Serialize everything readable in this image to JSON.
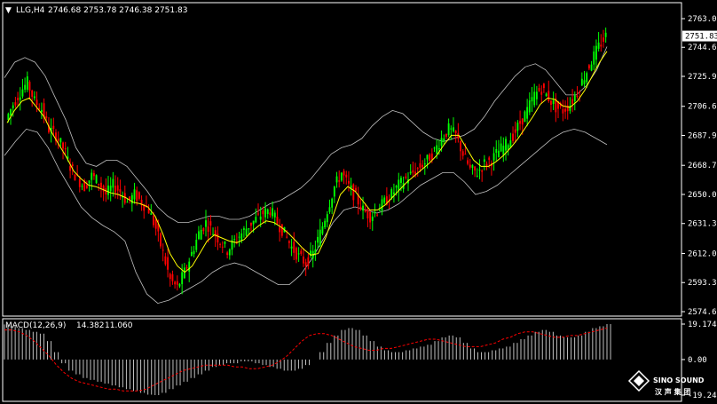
{
  "header": {
    "menu_glyph": "▼",
    "symbol": "LLG,H4",
    "ohlc": "2746.68 2753.78 2746.38 2751.83"
  },
  "macd": {
    "label": "MACD(12,26,9)",
    "main_value": "14.382",
    "signal_value": "11.060",
    "axis_ticks": [
      "19.174",
      "0.00",
      "-19.24"
    ]
  },
  "watermark": {
    "brand": "SINO SOUND",
    "cjk": "汉 声 集 团"
  },
  "colors": {
    "background": "#000000",
    "bull": "#00FF00",
    "bear": "#FF0000",
    "price_label_bg": "#FFFFFF",
    "ma_line": "#FFFF00",
    "band": "#C0C0C0",
    "macd_hist": "#C0C0C0",
    "macd_signal": "#FF0000"
  },
  "chart_data": {
    "type": "candlestick",
    "y_axis_ticks": [
      "2763.00",
      "2744.60",
      "2725.90",
      "2706.65",
      "2687.95",
      "2668.70",
      "2650.00",
      "2631.30",
      "2612.05",
      "2593.35",
      "2574.65"
    ],
    "last_price": "2751.83",
    "ylim": [
      2574.65,
      2763.0
    ],
    "price_path": [
      2698,
      2708,
      2716,
      2722,
      2710,
      2705,
      2692,
      2688,
      2680,
      2668,
      2660,
      2655,
      2662,
      2658,
      2650,
      2656,
      2652,
      2645,
      2650,
      2645,
      2640,
      2628,
      2612,
      2595,
      2590,
      2600,
      2612,
      2625,
      2632,
      2626,
      2620,
      2614,
      2620,
      2625,
      2630,
      2634,
      2638,
      2640,
      2632,
      2625,
      2616,
      2610,
      2606,
      2612,
      2625,
      2640,
      2655,
      2664,
      2655,
      2648,
      2640,
      2636,
      2640,
      2645,
      2650,
      2656,
      2660,
      2664,
      2668,
      2672,
      2678,
      2686,
      2692,
      2688,
      2676,
      2666,
      2664,
      2670,
      2672,
      2678,
      2682,
      2688,
      2696,
      2704,
      2714,
      2718,
      2712,
      2706,
      2704,
      2708,
      2716,
      2726,
      2736,
      2745,
      2751.83
    ],
    "ma_fast": [
      2696,
      2704,
      2710,
      2712,
      2706,
      2700,
      2690,
      2682,
      2674,
      2665,
      2660,
      2656,
      2655,
      2653,
      2651,
      2650,
      2648,
      2645,
      2644,
      2642,
      2636,
      2625,
      2612,
      2604,
      2600,
      2604,
      2612,
      2620,
      2624,
      2622,
      2620,
      2619,
      2621,
      2626,
      2630,
      2633,
      2632,
      2629,
      2625,
      2620,
      2615,
      2611,
      2612,
      2622,
      2636,
      2650,
      2655,
      2652,
      2646,
      2640,
      2640,
      2643,
      2648,
      2653,
      2658,
      2662,
      2666,
      2670,
      2675,
      2682,
      2688,
      2688,
      2680,
      2672,
      2668,
      2668,
      2671,
      2675,
      2680,
      2686,
      2693,
      2700,
      2708,
      2712,
      2711,
      2707,
      2706,
      2710,
      2717,
      2726,
      2735,
      2742
    ],
    "band_upper": [
      2725,
      2735,
      2738,
      2735,
      2726,
      2712,
      2698,
      2680,
      2670,
      2668,
      2672,
      2672,
      2668,
      2660,
      2652,
      2642,
      2636,
      2632,
      2632,
      2634,
      2636,
      2636,
      2634,
      2634,
      2636,
      2640,
      2644,
      2646,
      2650,
      2654,
      2660,
      2668,
      2676,
      2680,
      2682,
      2686,
      2694,
      2700,
      2704,
      2702,
      2696,
      2690,
      2686,
      2684,
      2686,
      2688,
      2692,
      2700,
      2710,
      2718,
      2726,
      2732,
      2734,
      2730,
      2722,
      2714,
      2714,
      2720,
      2730,
      2745
    ],
    "band_lower": [
      2675,
      2684,
      2692,
      2690,
      2680,
      2666,
      2654,
      2642,
      2635,
      2630,
      2626,
      2620,
      2600,
      2586,
      2580,
      2582,
      2586,
      2590,
      2594,
      2600,
      2604,
      2606,
      2604,
      2600,
      2596,
      2592,
      2592,
      2598,
      2608,
      2620,
      2632,
      2640,
      2642,
      2640,
      2638,
      2640,
      2644,
      2650,
      2656,
      2660,
      2664,
      2664,
      2658,
      2650,
      2652,
      2656,
      2662,
      2668,
      2674,
      2680,
      2686,
      2690,
      2692,
      2690,
      2686,
      2682
    ],
    "macd_histogram": [
      19,
      18,
      17,
      16,
      15,
      14,
      10,
      4,
      -2,
      -6,
      -8,
      -10,
      -11,
      -12,
      -13,
      -14,
      -15,
      -16,
      -17,
      -18,
      -19,
      -19.24,
      -18,
      -16,
      -14,
      -12,
      -10,
      -8,
      -6,
      -4,
      -3,
      -2,
      -2,
      -1,
      -1,
      -2,
      -3,
      -4,
      -5,
      -6,
      -6,
      -5,
      -3,
      0,
      4,
      9,
      13,
      16,
      17,
      16,
      13,
      10,
      7,
      5,
      4,
      4,
      5,
      6,
      7,
      8,
      10,
      12,
      13,
      12,
      9,
      6,
      4,
      4,
      5,
      6,
      7,
      9,
      11,
      13,
      15,
      16,
      15,
      13,
      12,
      12,
      13,
      15,
      17,
      18,
      19.174
    ],
    "macd_signal": [
      16,
      16,
      15,
      13,
      10,
      6,
      2,
      -3,
      -7,
      -10,
      -12,
      -13,
      -14,
      -15,
      -16,
      -16,
      -17,
      -17,
      -17,
      -16,
      -14,
      -12,
      -10,
      -8,
      -6,
      -5,
      -4,
      -3,
      -3,
      -3,
      -3,
      -4,
      -4,
      -5,
      -5,
      -4,
      -3,
      -1,
      2,
      6,
      10,
      13,
      14,
      14,
      13,
      11,
      9,
      7,
      6,
      5,
      5,
      6,
      6,
      7,
      8,
      9,
      10,
      11,
      11,
      10,
      9,
      8,
      7,
      7,
      7,
      8,
      9,
      11,
      12,
      14,
      15,
      15,
      14,
      13,
      12,
      12,
      13,
      13,
      14,
      15,
      16,
      17
    ]
  }
}
